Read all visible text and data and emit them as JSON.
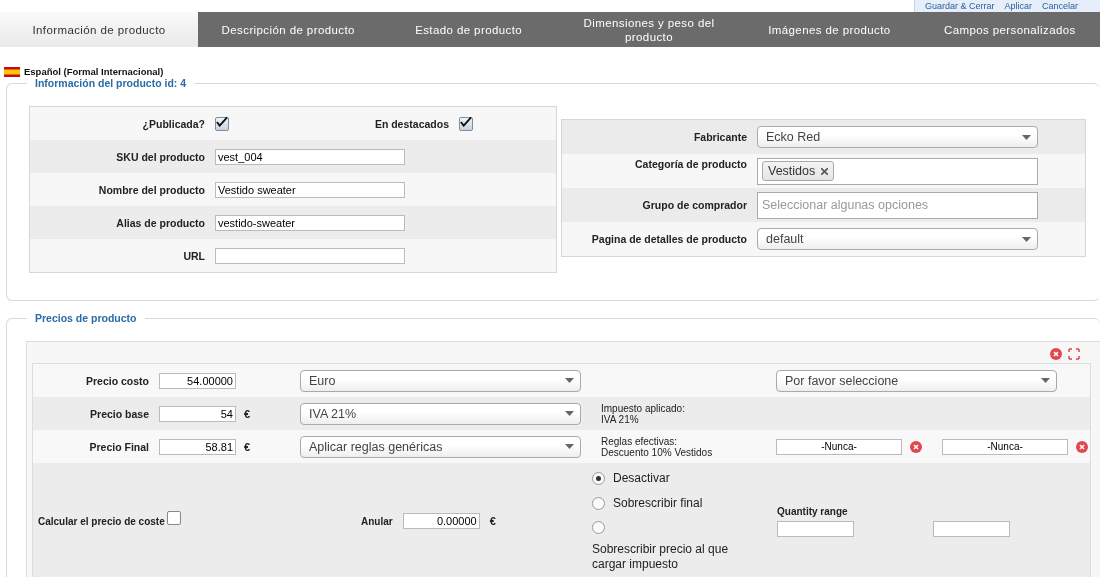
{
  "top_actions": [
    "Guardar & Cerrar",
    "Aplicar",
    "Cancelar"
  ],
  "tabs": [
    {
      "label": "Información de producto",
      "selected": true
    },
    {
      "label": "Descripción de producto",
      "selected": false
    },
    {
      "label": "Estado de producto",
      "selected": false
    },
    {
      "label": "Dimensiones y peso del producto",
      "selected": false
    },
    {
      "label": "Imágenes de producto",
      "selected": false
    },
    {
      "label": "Campos personalizados",
      "selected": false
    }
  ],
  "language": "Español (Formal Internacional)",
  "product_info": {
    "legend": "Información del producto id: 4",
    "flags": [
      {
        "label": "¿Publicada?",
        "checked": true
      },
      {
        "label": "En destacados",
        "checked": true
      }
    ],
    "fields": [
      {
        "label": "SKU del producto",
        "value": "vest_004"
      },
      {
        "label": "Nombre del producto",
        "value": "Vestido sweater"
      },
      {
        "label": "Alias de producto",
        "value": "vestido-sweater"
      },
      {
        "label": "URL"
      }
    ],
    "options": [
      {
        "kind": "select",
        "label": "Fabricante",
        "value": "Ecko Red"
      },
      {
        "kind": "tags",
        "label": "Categoría de producto",
        "tags": [
          "Vestidos"
        ]
      },
      {
        "kind": "multi",
        "label": "Grupo de comprador",
        "placeholder": "Seleccionar algunas opciones"
      },
      {
        "kind": "select",
        "label": "Pagina de detalles de producto",
        "value": "default"
      }
    ]
  },
  "prices": {
    "legend": "Precios de producto",
    "rows": [
      {
        "label": "Precio costo",
        "value": "54.00000",
        "select": "Euro",
        "info": [],
        "extra": {
          "kind": "select",
          "value": "Por favor seleccione"
        }
      },
      {
        "label": "Precio base",
        "value": "54",
        "currency": "€",
        "select": "IVA 21%",
        "info": [
          "Impuesto aplicado:",
          "IVA 21%"
        ]
      },
      {
        "label": "Precio Final",
        "value": "58.81",
        "currency": "€",
        "select": "Aplicar reglas genéricas",
        "info": [
          "Reglas efectivas:",
          "Descuento 10% Vestidos"
        ],
        "extra": {
          "kind": "dates",
          "values": [
            "-Nunca-",
            "-Nunca-"
          ]
        }
      }
    ],
    "calc": {
      "label": "Calcular el precio de coste",
      "checked": false
    },
    "override": {
      "label": "Anular",
      "value": "0.00000",
      "currency": "€"
    },
    "override_modes": [
      {
        "label": "Desactivar",
        "selected": true
      },
      {
        "label": "Sobrescribir final",
        "selected": false
      },
      {
        "label": "Sobrescribir precio al que cargar impuesto",
        "selected": false
      }
    ],
    "quantity_range": {
      "label": "Quantity range"
    }
  }
}
